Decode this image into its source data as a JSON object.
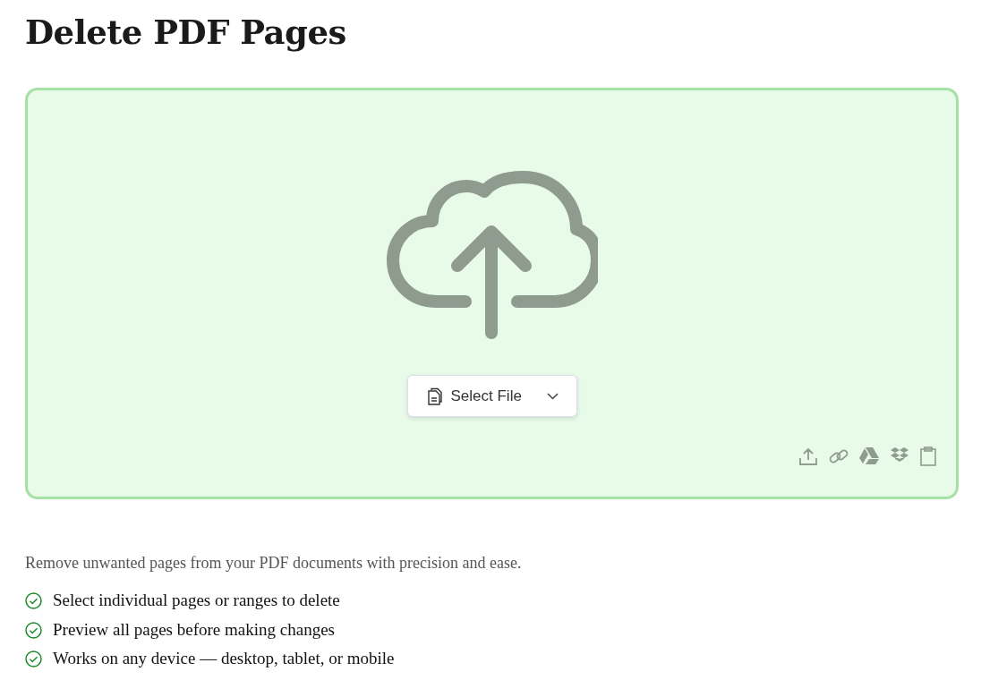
{
  "title": "Delete PDF Pages",
  "upload": {
    "button": "Select File"
  },
  "description": "Remove unwanted pages from your PDF documents with precision and ease.",
  "features": [
    "Select individual pages or ranges to delete",
    "Preview all pages before making changes",
    "Works on any device — desktop, tablet, or mobile"
  ]
}
